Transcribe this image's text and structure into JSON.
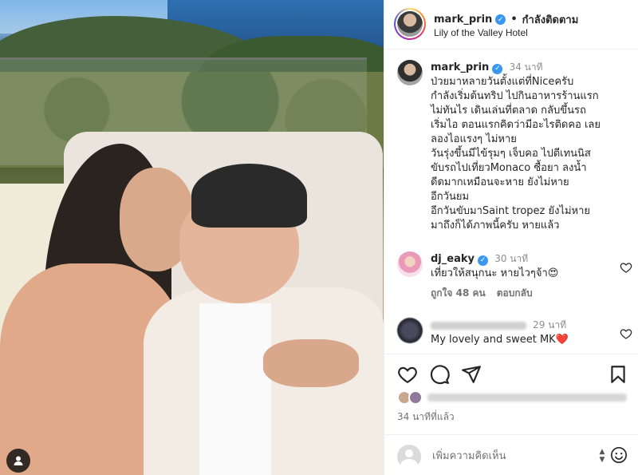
{
  "post": {
    "username": "mark_prin",
    "follow_status": "กำลังติดตาม",
    "location": "Lily of the Valley Hotel"
  },
  "caption": {
    "username": "mark_prin",
    "time": "34 นาที",
    "lines": [
      "ป่วยมาหลายวันตั้งแต่ที่Niceครับ",
      "กำลังเริ่มต้นทริป ไปกินอาหารร้านแรก",
      "ไม่ทันไร เดินเล่นที่ตลาด กลับขึ้นรถ",
      "เริ่มไอ ตอนแรกคิดว่ามีอะไรติดคอ เลย",
      "ลองไอแรงๆ ไม่หาย",
      "วันรุ่งขึ้นมีไข้รุมๆ เจ็บคอ ไปตีเทนนิส",
      "ขับรถไปเที่ยวMonaco ซื้อยา ลงน้ำ",
      "ดีดมากเหมือนจะหาย ยังไม่หาย",
      "อีกวันยม",
      "อีกวันขับมาSaint tropez ยังไม่หาย",
      "มาถึงก็ได้ภาพนี้ครับ หายแล้ว"
    ]
  },
  "comments": [
    {
      "username": "dj_eaky",
      "time": "30 นาที",
      "text": "เที่ยวให้สนุกนะ หายไวๆจ้า😍",
      "likes": "ถูกใจ 48 คน",
      "reply": "ตอบกลับ"
    },
    {
      "username": "",
      "time": "29 นาที",
      "text": "My lovely and sweet MK❤️"
    }
  ],
  "post_time": "34 นาทีที่แล้ว",
  "add_comment": {
    "placeholder": "เพิ่มความคิดเห็น"
  },
  "icons": {
    "verified": "verified-badge-icon",
    "heart": "heart-icon",
    "comment": "comment-icon",
    "share": "share-icon",
    "save": "bookmark-icon",
    "emoji": "emoji-icon",
    "tag": "user-tag-icon"
  },
  "colors": {
    "verified": "#3897f0",
    "muted": "#737373",
    "text": "#262626"
  }
}
